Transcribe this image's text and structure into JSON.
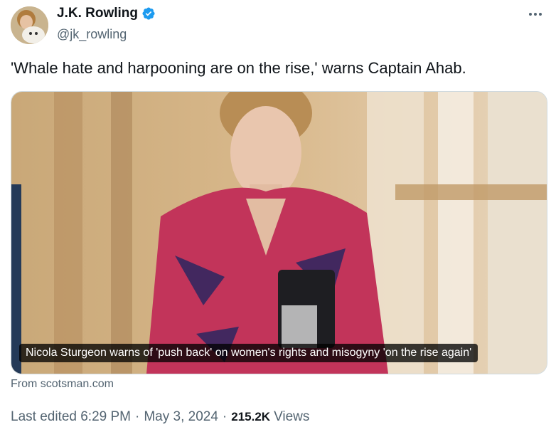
{
  "author": {
    "display_name": "J.K. Rowling",
    "handle": "@jk_rowling",
    "verified": true,
    "verified_color": "#1d9bf0"
  },
  "tweet": {
    "text": "'Whale hate and harpooning are on the rise,' warns Captain Ahab."
  },
  "card": {
    "caption": "Nicola Sturgeon warns of 'push back' on women's rights and misogyny 'on the rise again'",
    "source": "From scotsman.com"
  },
  "meta": {
    "edited": "Last edited 6:29 PM",
    "separator": "·",
    "date": "May 3, 2024",
    "views_count": "215.2K",
    "views_label": "Views"
  },
  "icons": {
    "verified": "verified-badge-icon",
    "more": "more-options-icon"
  }
}
